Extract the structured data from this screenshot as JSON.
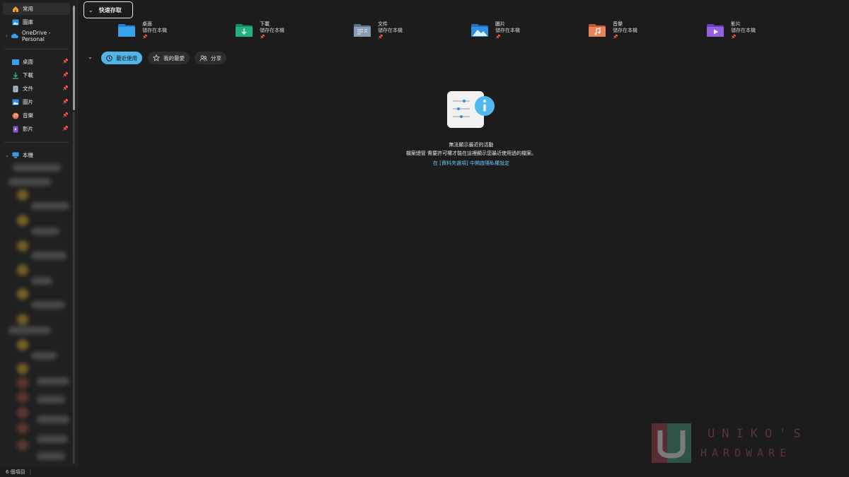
{
  "sidebar": {
    "top_items": [
      {
        "label": "常用",
        "icon": "home-icon",
        "active": true
      },
      {
        "label": "圖庫",
        "icon": "gallery-icon"
      },
      {
        "label": "OneDrive - Personal",
        "icon": "onedrive-icon",
        "expandable": true
      }
    ],
    "pinned_items": [
      {
        "label": "桌面",
        "icon": "desktop-folder-icon"
      },
      {
        "label": "下載",
        "icon": "downloads-icon"
      },
      {
        "label": "文件",
        "icon": "documents-icon"
      },
      {
        "label": "圖片",
        "icon": "pictures-icon"
      },
      {
        "label": "音樂",
        "icon": "music-icon"
      },
      {
        "label": "影片",
        "icon": "videos-icon"
      }
    ],
    "this_pc": {
      "label": "本機",
      "icon": "this-pc-icon"
    }
  },
  "quick_access": {
    "header": "快速存取",
    "folders": [
      {
        "name": "桌面",
        "location": "儲存在本機",
        "icon": "desktop-folder-icon",
        "color": "#3a9ee6"
      },
      {
        "name": "下載",
        "location": "儲存在本機",
        "icon": "downloads-folder-icon",
        "color": "#1fa87a"
      },
      {
        "name": "文件",
        "location": "儲存在本機",
        "icon": "documents-folder-icon",
        "color": "#7f94ad"
      },
      {
        "name": "圖片",
        "location": "儲存在本機",
        "icon": "pictures-folder-icon",
        "color": "#2f8fe0"
      },
      {
        "name": "音樂",
        "location": "儲存在本機",
        "icon": "music-folder-icon",
        "color": "#e0734a"
      },
      {
        "name": "影片",
        "location": "儲存在本機",
        "icon": "videos-folder-icon",
        "color": "#8a54d6"
      }
    ]
  },
  "tabs": [
    {
      "label": "最近使用",
      "icon": "clock-icon",
      "active": true
    },
    {
      "label": "我的最愛",
      "icon": "star-icon"
    },
    {
      "label": "分享",
      "icon": "people-icon"
    }
  ],
  "empty_state": {
    "title": "無法顯示最近的活動",
    "description": "檔案總管 需要許可權才能在這裡顯示您最近使用過的檔案。",
    "link": "在 [資料夾選項] 中開啟隱私權設定"
  },
  "status_bar": {
    "item_count": "6 個項目"
  },
  "watermark": {
    "line1": "UNIKO'S",
    "line2": "HARDWARE"
  },
  "colors": {
    "accent": "#52b5ea",
    "link": "#6cc5f5"
  }
}
